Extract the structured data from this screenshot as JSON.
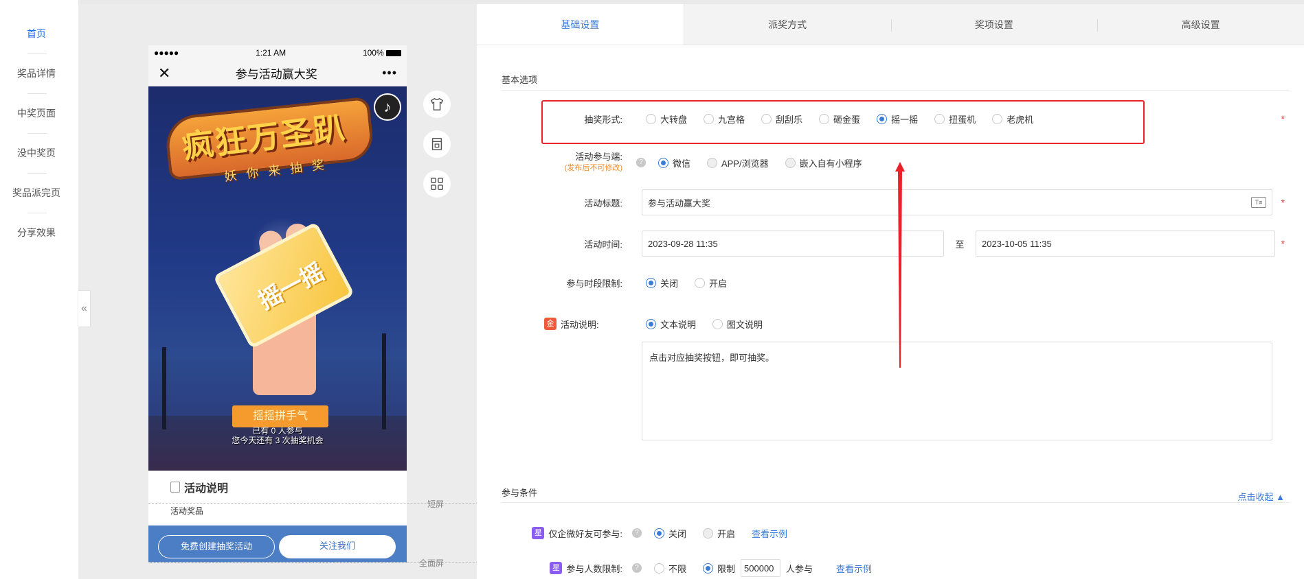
{
  "nav": {
    "items": [
      {
        "label": "首页",
        "active": true
      },
      {
        "label": "奖品详情"
      },
      {
        "label": "中奖页面"
      },
      {
        "label": "没中奖页"
      },
      {
        "label": "奖品派完页"
      },
      {
        "label": "分享效果"
      }
    ],
    "collapse": "«"
  },
  "phone": {
    "status_carrier": "●●●●●",
    "status_time": "1:21 AM",
    "status_battery": "100%",
    "title": "参与活动赢大奖",
    "close_icon": "✕",
    "more_icon": "•••",
    "banner_title": "疯狂万圣趴",
    "banner_sub": "妖你来抽奖",
    "card_text": "摇一摇",
    "ribbon": "摇摇拼手气",
    "participants_line1": "已有 0 人参与",
    "participants_line2": "您今天还有 3 次抽奖机会",
    "info_title": "活动说明",
    "info_sub": "活动奖品",
    "btn_create": "免费创建抽奖活动",
    "btn_follow": "关注我们",
    "music_icon": "♪"
  },
  "screen_labels": {
    "short": "短屏",
    "full": "全面屏"
  },
  "tabs": [
    {
      "label": "基础设置",
      "active": true
    },
    {
      "label": "派奖方式"
    },
    {
      "label": "奖项设置"
    },
    {
      "label": "高级设置"
    }
  ],
  "basic": {
    "section_title": "基本选项",
    "lottery_form": {
      "label": "抽奖形式:",
      "options": [
        "大转盘",
        "九宫格",
        "刮刮乐",
        "砸金蛋",
        "摇一摇",
        "扭蛋机",
        "老虎机"
      ],
      "selected": "摇一摇"
    },
    "platform": {
      "label": "活动参与端:",
      "note": "(发布后不可修改)",
      "options": [
        "微信",
        "APP/浏览器",
        "嵌入自有小程序"
      ],
      "selected": "微信"
    },
    "title": {
      "label": "活动标题:",
      "value": "参与活动赢大奖"
    },
    "time": {
      "label": "活动时间:",
      "start": "2023-09-28 11:35",
      "sep": "至",
      "end": "2023-10-05 11:35"
    },
    "period_limit": {
      "label": "参与时段限制:",
      "options": [
        "关闭",
        "开启"
      ],
      "selected": "关闭"
    },
    "description": {
      "badge": "金",
      "label": "活动说明:",
      "options": [
        "文本说明",
        "图文说明"
      ],
      "selected": "文本说明",
      "text": "点击对应抽奖按钮，即可抽奖。"
    },
    "required_mark": "*"
  },
  "conditions": {
    "section_title": "参与条件",
    "collapse_link": "点击收起",
    "wecom_only": {
      "badge": "星",
      "label": "仅企微好友可参与:",
      "options": [
        "关闭",
        "开启"
      ],
      "selected": "关闭",
      "example": "查看示例"
    },
    "count_limit": {
      "badge": "星",
      "label": "参与人数限制:",
      "options": [
        "不限",
        "限制"
      ],
      "selected": "限制",
      "value": "500000",
      "suffix": "人参与",
      "example": "查看示例"
    }
  },
  "colors": {
    "accent": "#3a7bd5",
    "highlight": "#e8212b",
    "note": "#f08c2a",
    "bottom_bar": "#4b7ec4"
  }
}
